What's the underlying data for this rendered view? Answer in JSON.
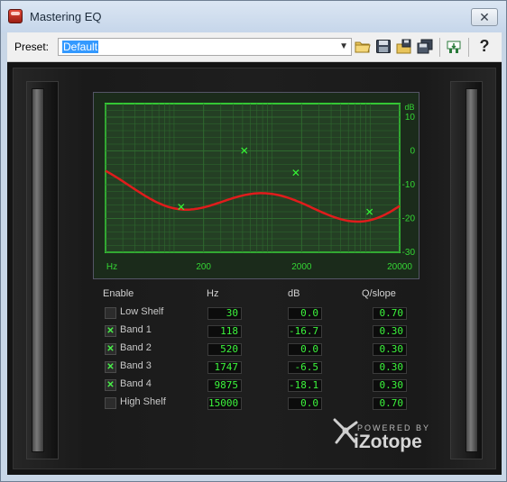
{
  "window": {
    "title": "Mastering EQ",
    "close_glyph": "✕"
  },
  "toolbar": {
    "preset_label": "Preset:",
    "preset_value": "Default",
    "icons": [
      "open-folder-icon",
      "save-icon",
      "save-as-icon",
      "save-all-icon",
      "output-icon",
      "help-icon"
    ],
    "help_glyph": "?"
  },
  "graph": {
    "db_unit": "dB",
    "db_ticks": [
      "10",
      "0",
      "-10",
      "-20",
      "-30"
    ],
    "hz_unit": "Hz",
    "hz_ticks": [
      "200",
      "2000",
      "20000"
    ],
    "colors": {
      "grid": "#2f6a2f",
      "border": "#36e636",
      "curve": "#e01c1c",
      "node": "#35f535",
      "label": "#34d534"
    }
  },
  "controls": {
    "headers": {
      "enable": "Enable",
      "hz": "Hz",
      "db": "dB",
      "q": "Q/slope"
    },
    "bands": [
      {
        "name": "Low Shelf",
        "enabled": false,
        "hz": "30",
        "db": "0.0",
        "q": "0.70"
      },
      {
        "name": "Band 1",
        "enabled": true,
        "hz": "118",
        "db": "-16.7",
        "q": "0.30"
      },
      {
        "name": "Band 2",
        "enabled": true,
        "hz": "520",
        "db": "0.0",
        "q": "0.30"
      },
      {
        "name": "Band 3",
        "enabled": true,
        "hz": "1747",
        "db": "-6.5",
        "q": "0.30"
      },
      {
        "name": "Band 4",
        "enabled": true,
        "hz": "9875",
        "db": "-18.1",
        "q": "0.30"
      },
      {
        "name": "High Shelf",
        "enabled": false,
        "hz": "15000",
        "db": "0.0",
        "q": "0.70"
      }
    ],
    "check_glyph": "✕"
  },
  "logo": {
    "powered_by": "POWERED BY",
    "brand": "iZotope"
  }
}
